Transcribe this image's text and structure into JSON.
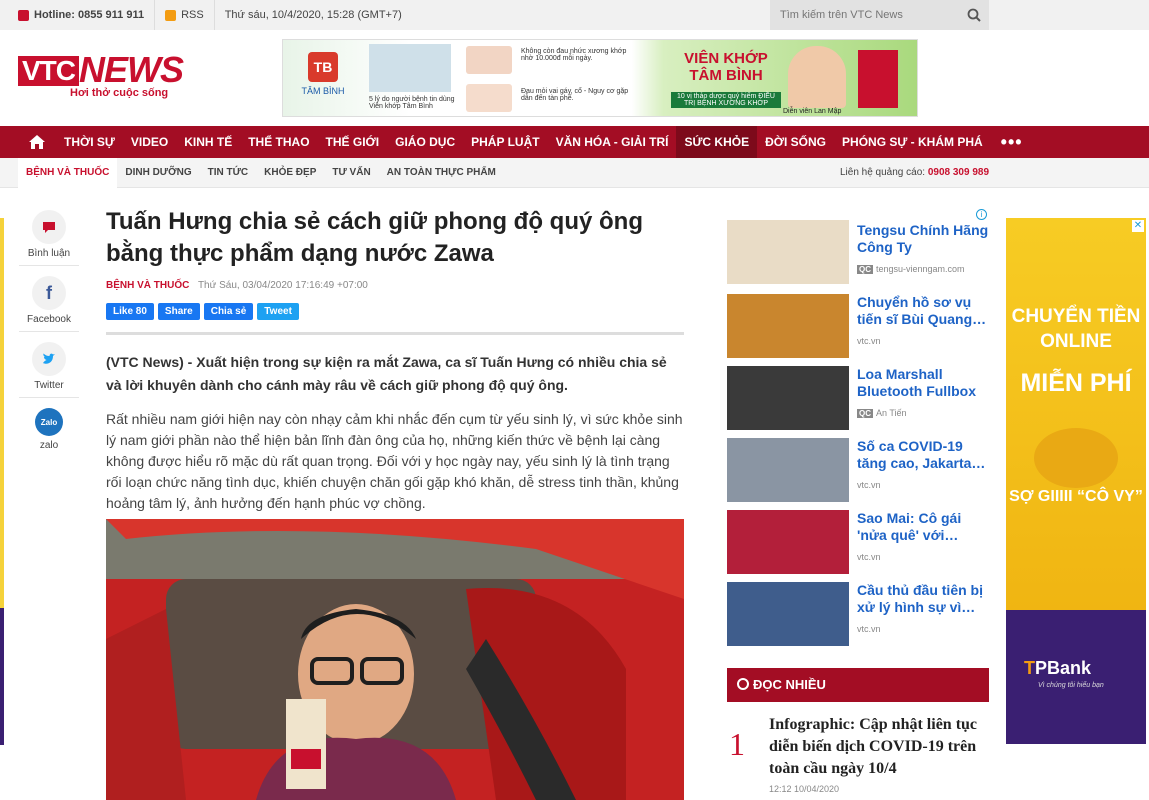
{
  "topbar": {
    "hotline": "Hotline: 0855 911 911",
    "rss": "RSS",
    "datetime": "Thứ sáu, 10/4/2020, 15:28 (GMT+7)",
    "search_placeholder": "Tìm kiếm trên VTC News"
  },
  "logo": {
    "vtc": "VTC",
    "news": "NEWS",
    "tagline": "Hơi thở cuộc sống"
  },
  "banner": {
    "brand": "TÂM BÌNH",
    "cap1": "5 lý do người bệnh tin dùng Viên khớp Tâm Bình",
    "txt2": "Không còn đau nhức xương khớp nhờ 10.000đ mỗi ngày.",
    "txt3": "Đau mỏi vai gáy, cổ - Nguy cơ gặp dẫn đến tàn phế.",
    "title": "VIÊN KHỚP TÂM BÌNH",
    "sub": "10 vị thảo dược quý hiếm ĐIỀU TRỊ BỆNH XƯƠNG KHỚP",
    "cap2": "Diễn viên Lan Mập"
  },
  "nav": {
    "items": [
      "THỜI SỰ",
      "VIDEO",
      "KINH TẾ",
      "THỂ THAO",
      "THẾ GIỚI",
      "GIÁO DỤC",
      "PHÁP LUẬT",
      "VĂN HÓA - GIẢI TRÍ",
      "SỨC KHỎE",
      "ĐỜI SỐNG",
      "PHÓNG SỰ - KHÁM PHÁ"
    ],
    "active_index": 8,
    "more": "•••"
  },
  "subnav": {
    "items": [
      "BỆNH VÀ THUỐC",
      "DINH DƯỠNG",
      "TIN TỨC",
      "KHỎE ĐẸP",
      "TƯ VẤN",
      "AN TOÀN THỰC PHẨM"
    ],
    "ad_contact_label": "Liên hệ quảng cáo:",
    "ad_contact_phone": "0908 309 989"
  },
  "share": {
    "comment": "Bình luận",
    "facebook": "Facebook",
    "twitter": "Twitter",
    "zalo": "zalo",
    "facebook_glyph": "f",
    "zalo_glyph": "Zalo"
  },
  "article": {
    "title": "Tuấn Hưng chia sẻ cách giữ phong độ quý ông bằng thực phẩm dạng nước Zawa",
    "category": "BỆNH VÀ THUỐC",
    "datetime": "Thứ Sáu, 03/04/2020 17:16:49 +07:00",
    "like": "Like 80",
    "share": "Share",
    "messenger": "Chia sẻ",
    "tweet": "Tweet",
    "lead": "(VTC News) - Xuất hiện trong sự kiện ra mắt Zawa, ca sĩ Tuấn Hưng có nhiều chia sẻ và lời khuyên dành cho cánh mày râu về cách giữ phong độ quý ông.",
    "body": "Rất nhiều nam giới hiện nay còn nhạy cảm khi nhắc đến cụm từ yếu sinh lý, vì sức khỏe sinh lý nam giới phần nào thể hiện bản lĩnh đàn ông của họ, những kiến thức về bệnh lại càng không được hiểu rõ mặc dù rất quan trọng. Đối với y học ngày nay, yếu sinh lý là tình trạng rối loạn chức năng tình dục, khiến chuyện chăn gối gặp khó khăn, dễ stress tinh thần, khủng hoảng tâm lý, ảnh hưởng đến hạnh phúc vợ chồng."
  },
  "sidebar": {
    "related": [
      {
        "title": "Tengsu Chính Hãng Công Ty",
        "source": "tengsu-vienngam.com",
        "qc": true,
        "color": "#e9dcc6"
      },
      {
        "title": "Chuyển hồ sơ vụ tiến sĩ Bùi Quang…",
        "source": "vtc.vn",
        "qc": false,
        "color": "#c9862e"
      },
      {
        "title": "Loa Marshall Bluetooth Fullbox",
        "source": "An Tiến",
        "qc": true,
        "color": "#3a3a3a"
      },
      {
        "title": "Số ca COVID-19 tăng cao, Jakarta…",
        "source": "vtc.vn",
        "qc": false,
        "color": "#8a95a3"
      },
      {
        "title": "Sao Mai: Cô gái 'nửa quê' với…",
        "source": "vtc.vn",
        "qc": false,
        "color": "#b31f3a"
      },
      {
        "title": "Cầu thủ đầu tiên bị xử lý hình sự vì…",
        "source": "vtc.vn",
        "qc": false,
        "color": "#3f5d8c"
      }
    ],
    "qc_label": "QC",
    "most_read_title": "ĐỌC NHIỀU",
    "most_read": [
      {
        "rank": "1",
        "title": "Infographic: Cập nhật liên tục diễn biến dịch COVID-19 trên toàn cầu ngày 10/4",
        "time": "12:12 10/04/2020"
      }
    ]
  },
  "right_ad": {
    "line1": "CHUYỂN TIỀN ONLINE",
    "line2": "MIỄN PHÍ",
    "line3": "SỢ GIIIII “CÔ VY”",
    "bank": "TPBank",
    "bank_sub": "Vì chúng tôi hiểu bạn"
  }
}
